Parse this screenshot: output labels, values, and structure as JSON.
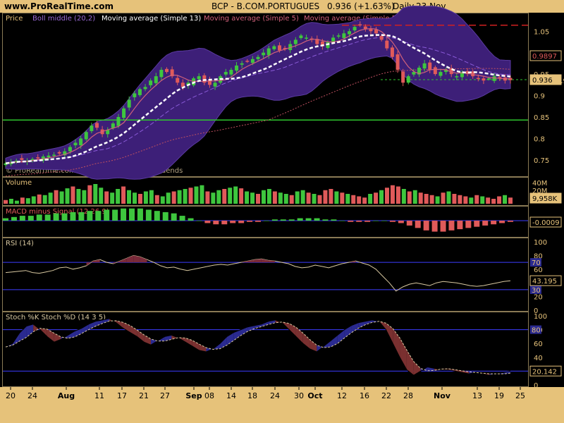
{
  "header": {
    "site": "www.ProRealTime.com",
    "symbol": "BCP - B.COM.PORTUGUES",
    "quote": "0.936 (+1.63%)",
    "period": "Daily",
    "date": "23 Nov"
  },
  "colors": {
    "bg": "#000000",
    "frame": "#e6c27a",
    "up": "#3ec63e",
    "down": "#e05a5a",
    "boll_band": "#3d1f78",
    "ma13": "#ffffff",
    "ma5": "#d0607a",
    "ma50": "#c05060",
    "support": "#2ec62e",
    "resistance": "#d02020",
    "rsi_line": "#d8c8a0",
    "level_line": "#3c3cff"
  },
  "price_panel": {
    "legend": [
      "Price",
      "Boll middle (20,2)",
      "Moving average (Simple 13)",
      "Moving average (Simple 5)",
      "Moving average (Simple 50)"
    ],
    "watermark": "© ProRealTime.com  Data adjusted after dividends",
    "last_value": "0.936",
    "marker_value": "0.9897",
    "marker_value_2": "0.95",
    "y_ticks": [
      "1.05",
      "1",
      "0.95",
      "0.9",
      "0.85",
      "0.8",
      "0.75"
    ],
    "support_level": 0.843,
    "resistance_level": 1.064,
    "dashed_level": 0.937
  },
  "volume_panel": {
    "label": "Volume",
    "y_ticks": [
      "40M",
      "20M"
    ],
    "last_value": "9,958K"
  },
  "macd_panel": {
    "label": "MACD minus Signal (12,26,9)",
    "last_value": "-0.0009"
  },
  "rsi_panel": {
    "label": "RSI (14)",
    "y_ticks": [
      "100",
      "80",
      "60",
      "40",
      "20",
      "0"
    ],
    "levels": [
      "70",
      "30"
    ],
    "last_value": "43.195"
  },
  "stoch_panel": {
    "label": "Stoch %K Stoch %D (14 3 5)",
    "y_ticks": [
      "100",
      "80",
      "60",
      "40",
      "20",
      "0"
    ],
    "levels": [
      "80"
    ],
    "last_value": "20.142"
  },
  "x_axis": {
    "labels": [
      "20",
      "24",
      "Aug",
      "11",
      "17",
      "21",
      "27",
      "Sep",
      "08",
      "14",
      "18",
      "24",
      "30",
      "Oct",
      "12",
      "16",
      "22",
      "28",
      "Nov",
      "13",
      "19",
      "25"
    ]
  },
  "chart_data": {
    "type": "candlestick",
    "title": "BCP - B.COM.PORTUGUES",
    "close": [
      0.742,
      0.745,
      0.748,
      0.75,
      0.748,
      0.752,
      0.755,
      0.758,
      0.76,
      0.762,
      0.765,
      0.77,
      0.78,
      0.79,
      0.8,
      0.815,
      0.83,
      0.825,
      0.81,
      0.82,
      0.835,
      0.85,
      0.87,
      0.89,
      0.905,
      0.915,
      0.92,
      0.935,
      0.945,
      0.96,
      0.955,
      0.945,
      0.93,
      0.92,
      0.93,
      0.94,
      0.945,
      0.93,
      0.925,
      0.93,
      0.945,
      0.955,
      0.96,
      0.97,
      0.975,
      0.98,
      0.985,
      0.99,
      1.0,
      1.01,
      1.015,
      1.005,
      1.01,
      1.02,
      1.03,
      1.04,
      1.035,
      1.03,
      1.02,
      1.015,
      1.025,
      1.035,
      1.04,
      1.045,
      1.05,
      1.06,
      1.065,
      1.055,
      1.05,
      1.045,
      1.03,
      1.01,
      0.99,
      0.96,
      0.93,
      0.945,
      0.955,
      0.965,
      0.975,
      0.96,
      0.95,
      0.955,
      0.96,
      0.95,
      0.945,
      0.955,
      0.95,
      0.945,
      0.94,
      0.935,
      0.94,
      0.945,
      0.94,
      0.935,
      0.936
    ],
    "volume_m": [
      6,
      8,
      5,
      10,
      9,
      12,
      15,
      14,
      18,
      22,
      20,
      25,
      28,
      24,
      22,
      30,
      32,
      26,
      20,
      18,
      24,
      28,
      22,
      18,
      16,
      20,
      22,
      14,
      12,
      18,
      20,
      22,
      24,
      26,
      28,
      30,
      20,
      18,
      22,
      24,
      26,
      28,
      25,
      20,
      18,
      16,
      22,
      24,
      20,
      18,
      16,
      14,
      20,
      22,
      18,
      16,
      14,
      22,
      24,
      20,
      18,
      16,
      14,
      12,
      10,
      16,
      18,
      22,
      26,
      30,
      28,
      24,
      20,
      22,
      18,
      16,
      14,
      12,
      18,
      20,
      16,
      14,
      12,
      10,
      14,
      12,
      10,
      8,
      12,
      14,
      10
    ],
    "macd_minus_signal": [
      0.002,
      0.003,
      0.004,
      0.004,
      0.005,
      0.005,
      0.006,
      0.006,
      0.007,
      0.007,
      0.008,
      0.008,
      0.009,
      0.009,
      0.01,
      0.01,
      0.01,
      0.009,
      0.008,
      0.007,
      0.006,
      0.004,
      0.002,
      0.0,
      -0.002,
      -0.003,
      -0.003,
      -0.002,
      -0.002,
      -0.001,
      -0.001,
      0.0,
      0.001,
      0.001,
      0.001,
      0.002,
      0.002,
      0.002,
      0.001,
      0.001,
      0.0,
      -0.001,
      -0.001,
      -0.001,
      0.0,
      0.0,
      -0.001,
      -0.002,
      -0.004,
      -0.006,
      -0.008,
      -0.009,
      -0.009,
      -0.008,
      -0.007,
      -0.006,
      -0.005,
      -0.004,
      -0.003,
      -0.002,
      -0.001
    ],
    "rsi": [
      55,
      56,
      57,
      58,
      55,
      54,
      56,
      58,
      62,
      63,
      60,
      62,
      65,
      72,
      74,
      70,
      68,
      72,
      76,
      80,
      78,
      74,
      70,
      65,
      62,
      63,
      60,
      58,
      60,
      62,
      64,
      66,
      67,
      66,
      68,
      70,
      72,
      74,
      75,
      73,
      72,
      70,
      68,
      64,
      62,
      63,
      66,
      64,
      62,
      65,
      68,
      70,
      72,
      69,
      66,
      60,
      50,
      40,
      28,
      34,
      38,
      40,
      38,
      36,
      40,
      42,
      41,
      40,
      38,
      36,
      35,
      36,
      38,
      40,
      42,
      43
    ],
    "stoch_k": [
      55,
      60,
      75,
      85,
      88,
      80,
      70,
      62,
      66,
      72,
      78,
      82,
      88,
      92,
      94,
      96,
      90,
      82,
      76,
      70,
      62,
      58,
      64,
      70,
      72,
      68,
      62,
      56,
      50,
      48,
      52,
      60,
      70,
      76,
      80,
      84,
      86,
      88,
      92,
      94,
      90,
      80,
      70,
      60,
      52,
      48,
      56,
      64,
      72,
      80,
      86,
      90,
      92,
      94,
      92,
      80,
      60,
      40,
      22,
      14,
      20,
      26,
      24,
      22,
      22,
      20,
      18,
      16,
      18,
      16,
      14,
      16,
      18,
      20
    ]
  }
}
